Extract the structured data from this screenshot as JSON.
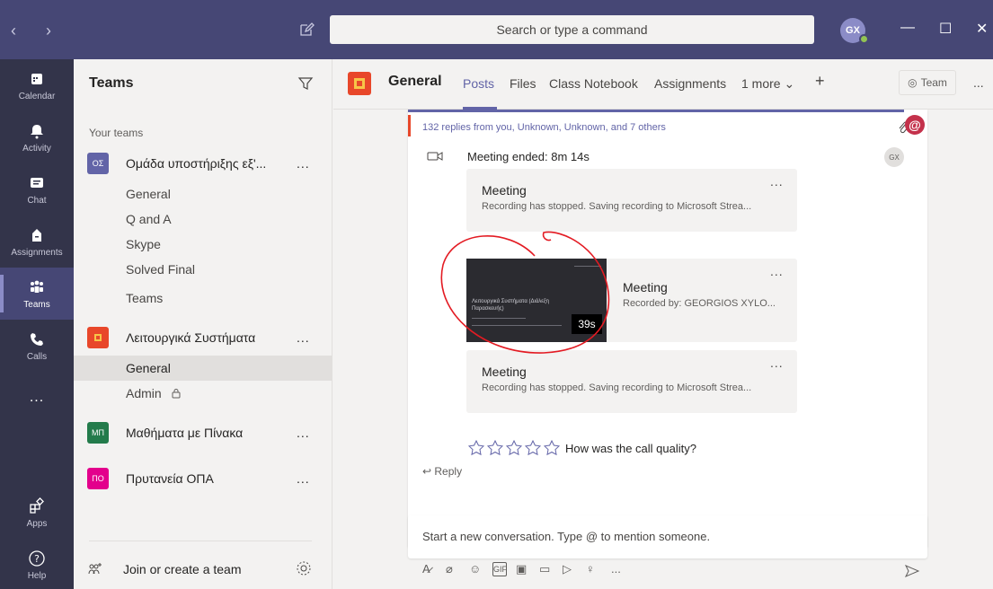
{
  "titlebar": {
    "search_placeholder": "Search or type a command",
    "avatar_initials": "GX"
  },
  "rail": {
    "items": [
      {
        "label": "Calendar",
        "icon": "calendar-icon"
      },
      {
        "label": "Activity",
        "icon": "bell-icon"
      },
      {
        "label": "Chat",
        "icon": "chat-icon"
      },
      {
        "label": "Assignments",
        "icon": "assignments-icon"
      },
      {
        "label": "Teams",
        "icon": "teams-icon",
        "active": true
      },
      {
        "label": "Calls",
        "icon": "phone-icon"
      },
      {
        "label": "...",
        "icon": "more-icon"
      },
      {
        "label": "Apps",
        "icon": "apps-icon"
      },
      {
        "label": "Help",
        "icon": "help-icon"
      }
    ]
  },
  "panel": {
    "title": "Teams",
    "section_label": "Your teams",
    "teams": [
      {
        "name": "Ομάδα υποστήριξης εξ'...",
        "logo_text": "ΟΣ",
        "logo_color": "#6264a7",
        "channels": [
          "General",
          "Q and A",
          "Skype",
          "Solved Final",
          "Teams"
        ]
      },
      {
        "name": "Λειτουργικά Συστήματα",
        "logo_text": "",
        "logo_color": "#e8472a",
        "channels": [
          "General",
          "Admin"
        ]
      },
      {
        "name": "Μαθήματα με Πίνακα",
        "logo_text": "ΜΠ",
        "logo_color": "#237b4b",
        "channels": []
      },
      {
        "name": "Πρυτανεία ΟΠΑ",
        "logo_text": "ΠΟ",
        "logo_color": "#e3008c",
        "channels": []
      }
    ],
    "team_more": "...",
    "join_label": "Join or create a team"
  },
  "main": {
    "channel_title": "General",
    "tabs": [
      "Posts",
      "Files",
      "Class Notebook",
      "Assignments",
      "1 more"
    ],
    "team_button": "Team",
    "header_more": "...",
    "replies_text": "132 replies from you, Unknown, Unknown, and 7 others",
    "meeting_ended": "Meeting ended: 8m 14s",
    "small_avatar": "GX",
    "meetings": [
      {
        "title": "Meeting",
        "subtitle": "Recording has stopped. Saving recording to Microsoft Strea..."
      },
      {
        "title": "Meeting",
        "subtitle": "Recorded by: GEORGIOS XYLO...",
        "duration": "39s",
        "thumb_title": "Λειτουργικά Συστήματα (Διάλεξη Παρασκευής)"
      },
      {
        "title": "Meeting",
        "subtitle": "Recording has stopped. Saving recording to Microsoft Strea..."
      }
    ],
    "card_more": "...",
    "quality_prompt": "How was the call quality?",
    "reply_label": "Reply",
    "compose_placeholder": "Start a new conversation. Type @ to mention someone.",
    "toolbar_more": "..."
  },
  "colors": {
    "titlebar": "#464775",
    "rail": "#33344a",
    "accent": "#6264a7",
    "annotation": "#e31b23"
  }
}
